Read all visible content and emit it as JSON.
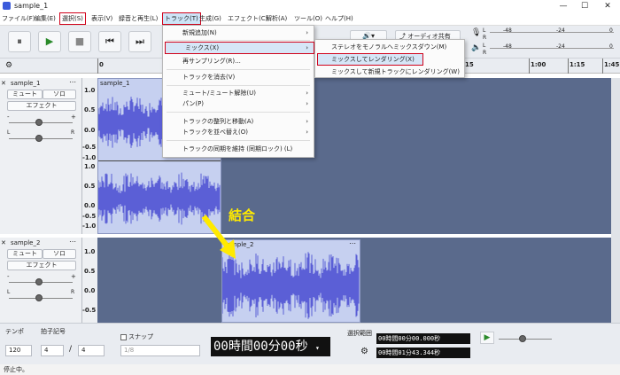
{
  "window": {
    "title": "sample_1",
    "minimize": "—",
    "maximize": "☐",
    "close": "✕"
  },
  "menubar": [
    "ファイル(F)",
    "編集(E)",
    "選択(S)",
    "表示(V)",
    "録音と再生(L)",
    "トラック(T)",
    "生成(G)",
    "エフェクト(C)",
    "解析(A)",
    "ツール(O)",
    "ヘルプ(H)"
  ],
  "toolbar": {
    "pause": "⏸",
    "play": "▶",
    "stop": "■",
    "skip_start": "⏮",
    "skip_end": "⏭",
    "audio_setup": "🔊▾",
    "share_audio": "オーディオ共有"
  },
  "meters": {
    "rec": {
      "left": "L",
      "right": "R",
      "ticks": [
        "-48",
        "-24",
        "0"
      ]
    },
    "play": {
      "left": "L",
      "right": "R",
      "ticks": [
        "-48",
        "-24",
        "0"
      ]
    }
  },
  "ruler": {
    "ticks": [
      "0",
      "15",
      "30",
      "1:00",
      "1:15",
      "1:30",
      "1:45"
    ],
    "visible_ticks": [
      "0",
      "15",
      "1:00",
      "1:15",
      "1:30",
      "1:45"
    ]
  },
  "tracks": [
    {
      "name": "sample_1",
      "mute": "ミュート",
      "solo": "ソロ",
      "effects": "エフェクト",
      "gain_minus": "-",
      "gain_plus": "+",
      "pan_left": "L",
      "pan_right": "R",
      "clip": "sample_1",
      "scale": [
        "1.0",
        "0.5",
        "0.0",
        "-0.5",
        "-1.0",
        "1.0",
        "0.5",
        "0.0",
        "-0.5",
        "-1.0"
      ]
    },
    {
      "name": "sample_2",
      "mute": "ミュート",
      "solo": "ソロ",
      "effects": "エフェクト",
      "gain_minus": "-",
      "gain_plus": "+",
      "pan_left": "L",
      "pan_right": "R",
      "clip": "sample_2",
      "scale": [
        "1.0",
        "0.5",
        "0.0",
        "-0.5"
      ]
    }
  ],
  "track_menu": {
    "items": [
      {
        "label": "新規追加(N)",
        "submenu": true
      },
      {
        "label": "ミックス(X)",
        "submenu": true
      },
      {
        "label": "再サンプリング(R)...",
        "submenu": false
      },
      {
        "label": "トラックを消去(V)",
        "submenu": false
      },
      {
        "label": "ミュート/ミュート解除(U)",
        "submenu": true
      },
      {
        "label": "パン(P)",
        "submenu": true
      },
      {
        "label": "トラックの整列と移動(A)",
        "submenu": true
      },
      {
        "label": "トラックを並べ替え(O)",
        "submenu": true
      },
      {
        "label": "トラックの同期を維持 (同期ロック) (L)",
        "submenu": false
      }
    ]
  },
  "mix_submenu": {
    "items": [
      "ステレオをモノラルへミックスダウン(M)",
      "ミックスしてレンダリング(X)",
      "ミックスして新規トラックにレンダリング(W)"
    ]
  },
  "annotation": {
    "label": "結合"
  },
  "bottom": {
    "tempo_label": "テンポ",
    "tempo_value": "120",
    "timesig_label": "拍子記号",
    "timesig_num": "4",
    "timesig_slash": "/",
    "timesig_den": "4",
    "snap_label": "スナップ",
    "snap_value": "1/8",
    "time_display": "00時間00分00秒",
    "selection_label": "選択範囲",
    "selection_start": "00時間00分00.000秒",
    "selection_end": "00時間01分43.344秒",
    "settings_icon": "⚙"
  },
  "status": {
    "text": "停止中。"
  },
  "colors": {
    "wave": "#5b5fd6",
    "track_bg": "#5a6a8c",
    "clip_bg": "#c6d0f0",
    "highlight": "#d0021b",
    "arrow": "#ffea00"
  }
}
